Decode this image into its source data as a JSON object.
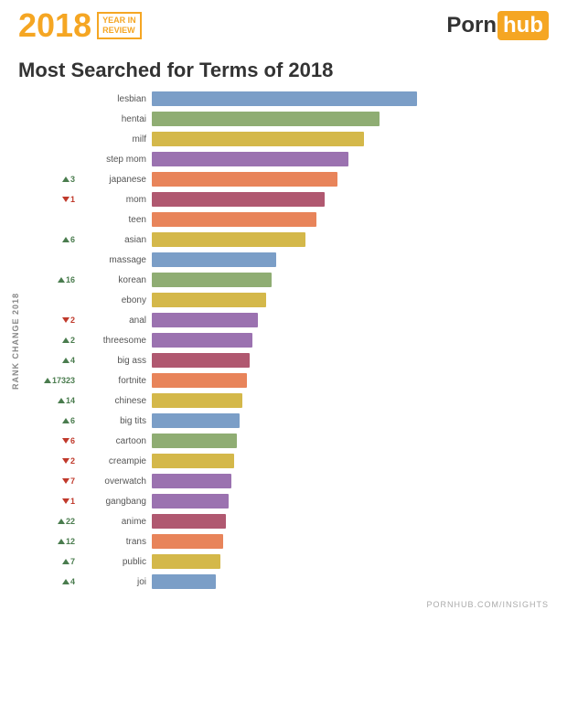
{
  "header": {
    "year": "2018",
    "year_label_line1": "YEAR IN",
    "year_label_line2": "REVIEW",
    "logo_part1": "Porn",
    "logo_part2": "hub"
  },
  "title": "Most Searched for Terms of 2018",
  "footer": "PORNHUB.COM/INSIGHTS",
  "chart": {
    "y_axis_label": "RANK CHANGE 2018",
    "max_bar_width": 290,
    "bars": [
      {
        "term": "lesbian",
        "pct": 100,
        "color": "#7b9ec7",
        "rank_dir": "",
        "rank_val": ""
      },
      {
        "term": "hentai",
        "pct": 86,
        "color": "#8fad73",
        "rank_dir": "",
        "rank_val": ""
      },
      {
        "term": "milf",
        "pct": 80,
        "color": "#d4b84a",
        "rank_dir": "",
        "rank_val": ""
      },
      {
        "term": "step mom",
        "pct": 74,
        "color": "#9b72b0",
        "rank_dir": "",
        "rank_val": ""
      },
      {
        "term": "japanese",
        "pct": 70,
        "color": "#e8845a",
        "rank_dir": "up",
        "rank_val": "3"
      },
      {
        "term": "mom",
        "pct": 65,
        "color": "#b05870",
        "rank_dir": "down",
        "rank_val": "1"
      },
      {
        "term": "teen",
        "pct": 62,
        "color": "#e8845a",
        "rank_dir": "",
        "rank_val": ""
      },
      {
        "term": "asian",
        "pct": 58,
        "color": "#d4b84a",
        "rank_dir": "up",
        "rank_val": "6"
      },
      {
        "term": "massage",
        "pct": 47,
        "color": "#7b9ec7",
        "rank_dir": "",
        "rank_val": ""
      },
      {
        "term": "korean",
        "pct": 45,
        "color": "#8fad73",
        "rank_dir": "up",
        "rank_val": "16"
      },
      {
        "term": "ebony",
        "pct": 43,
        "color": "#d4b84a",
        "rank_dir": "",
        "rank_val": ""
      },
      {
        "term": "anal",
        "pct": 40,
        "color": "#9b72b0",
        "rank_dir": "down",
        "rank_val": "2"
      },
      {
        "term": "threesome",
        "pct": 38,
        "color": "#9b72b0",
        "rank_dir": "up",
        "rank_val": "2"
      },
      {
        "term": "big ass",
        "pct": 37,
        "color": "#b05870",
        "rank_dir": "up",
        "rank_val": "4"
      },
      {
        "term": "fortnite",
        "pct": 36,
        "color": "#e8845a",
        "rank_dir": "up",
        "rank_val": "17323"
      },
      {
        "term": "chinese",
        "pct": 34,
        "color": "#d4b84a",
        "rank_dir": "up",
        "rank_val": "14"
      },
      {
        "term": "big tits",
        "pct": 33,
        "color": "#7b9ec7",
        "rank_dir": "up",
        "rank_val": "6"
      },
      {
        "term": "cartoon",
        "pct": 32,
        "color": "#8fad73",
        "rank_dir": "down",
        "rank_val": "6"
      },
      {
        "term": "creampie",
        "pct": 31,
        "color": "#d4b84a",
        "rank_dir": "down",
        "rank_val": "2"
      },
      {
        "term": "overwatch",
        "pct": 30,
        "color": "#9b72b0",
        "rank_dir": "down",
        "rank_val": "7"
      },
      {
        "term": "gangbang",
        "pct": 29,
        "color": "#9b72b0",
        "rank_dir": "down",
        "rank_val": "1"
      },
      {
        "term": "anime",
        "pct": 28,
        "color": "#b05870",
        "rank_dir": "up",
        "rank_val": "22"
      },
      {
        "term": "trans",
        "pct": 27,
        "color": "#e8845a",
        "rank_dir": "up",
        "rank_val": "12"
      },
      {
        "term": "public",
        "pct": 26,
        "color": "#d4b84a",
        "rank_dir": "up",
        "rank_val": "7"
      },
      {
        "term": "joi",
        "pct": 24,
        "color": "#7b9ec7",
        "rank_dir": "up",
        "rank_val": "4"
      }
    ]
  }
}
